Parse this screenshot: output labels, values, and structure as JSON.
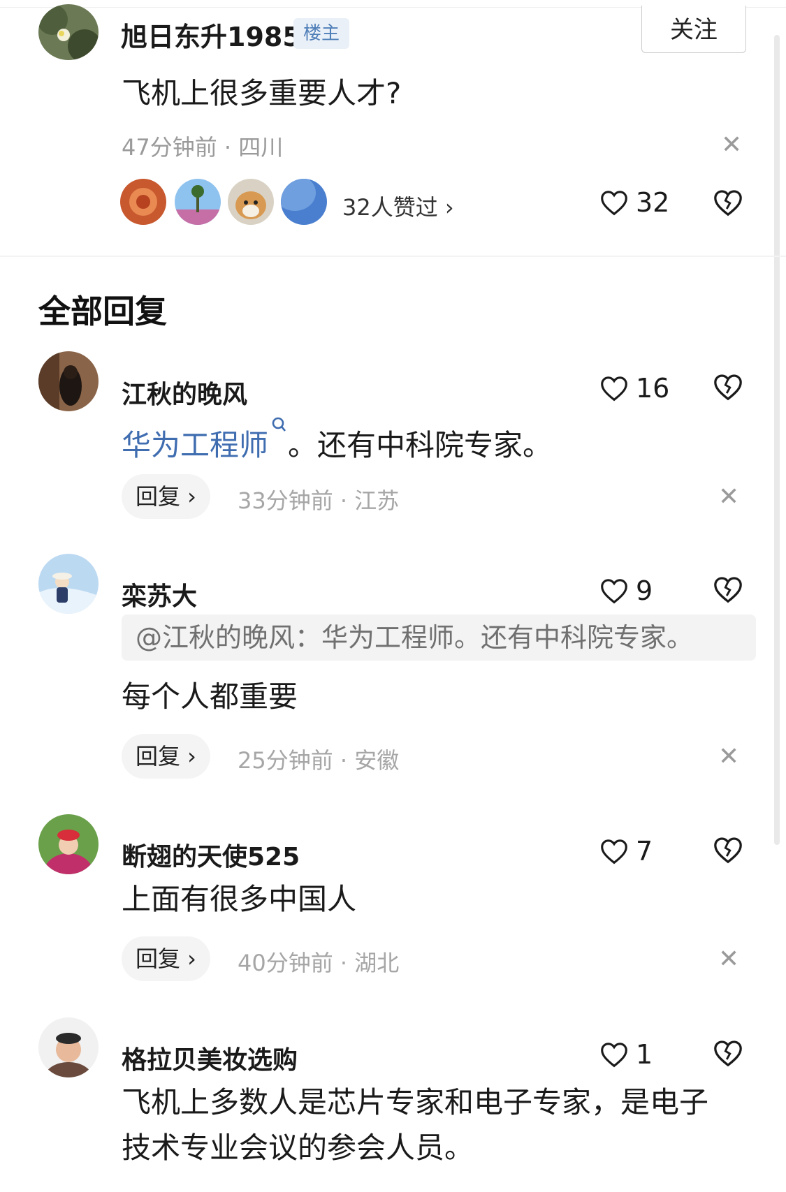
{
  "post": {
    "username": "旭日东升1985",
    "badge": "楼主",
    "follow_label": "关注",
    "text": "飞机上很多重要人才?",
    "meta": "47分钟前 · 四川",
    "liked_by": "32人赞过 ›",
    "likes": "32"
  },
  "section_title": "全部回复",
  "comments": [
    {
      "username": "江秋的晚风",
      "likes": "16",
      "text_link": "华为工程师",
      "text_rest": "。还有中科院专家。",
      "reply_label": "回复 ›",
      "meta": "33分钟前 · 江苏"
    },
    {
      "username": "栾苏大",
      "likes": "9",
      "quote": "@江秋的晚风：华为工程师。还有中科院专家。",
      "text": "每个人都重要",
      "reply_label": "回复 ›",
      "meta": "25分钟前 · 安徽"
    },
    {
      "username": "断翅的天使525",
      "likes": "7",
      "text": "上面有很多中国人",
      "reply_label": "回复 ›",
      "meta": "40分钟前 · 湖北"
    },
    {
      "username": "格拉贝美妆选购",
      "likes": "1",
      "text_line1": "飞机上多数人是芯片专家和电子专家，是电子",
      "text_line2": "技术专业会议的参会人员。"
    }
  ],
  "colors": {
    "link": "#3f6db0",
    "meta": "#9a9a9a",
    "badge_bg": "#eaf0f8",
    "pill_bg": "#f4f4f4"
  },
  "icons": [
    "heart-outline-icon",
    "broken-heart-icon",
    "close-icon",
    "search-icon"
  ]
}
